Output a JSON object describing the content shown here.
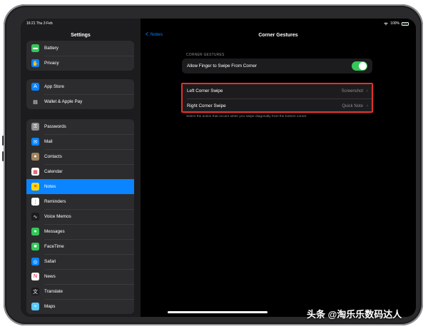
{
  "status": {
    "time_date": "16:21  Thu 3 Feb",
    "battery": "100%"
  },
  "sidebar": {
    "title": "Settings",
    "group1": [
      {
        "label": "Battery",
        "icon": "battery-icon",
        "color": "#34c759",
        "glyph": "▬"
      },
      {
        "label": "Privacy",
        "icon": "hand-icon",
        "color": "#0a84ff",
        "glyph": "✋"
      }
    ],
    "group2": [
      {
        "label": "App Store",
        "icon": "app-store-icon",
        "color": "#0a84ff",
        "glyph": "A"
      },
      {
        "label": "Wallet & Apple Pay",
        "icon": "wallet-icon",
        "color": "#2c2c2e",
        "glyph": "▤"
      }
    ],
    "group3": [
      {
        "label": "Passwords",
        "icon": "key-icon",
        "color": "#8e8e93",
        "glyph": "⚿"
      },
      {
        "label": "Mail",
        "icon": "mail-icon",
        "color": "#0a84ff",
        "glyph": "✉"
      },
      {
        "label": "Contacts",
        "icon": "contacts-icon",
        "color": "#a2845e",
        "glyph": "●"
      },
      {
        "label": "Calendar",
        "icon": "calendar-icon",
        "color": "#ffffff",
        "glyph": "▦"
      },
      {
        "label": "Notes",
        "icon": "notes-icon",
        "color": "#ffd60a",
        "glyph": "≡",
        "selected": true
      },
      {
        "label": "Reminders",
        "icon": "reminders-icon",
        "color": "#ffffff",
        "glyph": "⋮"
      },
      {
        "label": "Voice Memos",
        "icon": "voice-memos-icon",
        "color": "#1c1c1e",
        "glyph": "∿"
      },
      {
        "label": "Messages",
        "icon": "messages-icon",
        "color": "#34c759",
        "glyph": "●"
      },
      {
        "label": "FaceTime",
        "icon": "facetime-icon",
        "color": "#34c759",
        "glyph": "■"
      },
      {
        "label": "Safari",
        "icon": "safari-icon",
        "color": "#0a84ff",
        "glyph": "◎"
      },
      {
        "label": "News",
        "icon": "news-icon",
        "color": "#ffffff",
        "glyph": "N"
      },
      {
        "label": "Translate",
        "icon": "translate-icon",
        "color": "#1c1c1e",
        "glyph": "文"
      },
      {
        "label": "Maps",
        "icon": "maps-icon",
        "color": "#5ac8fa",
        "glyph": "⌖"
      }
    ]
  },
  "main": {
    "back_label": "Notes",
    "title": "Corner Gestures",
    "section_header": "CORNER GESTURES",
    "allow_row": {
      "label": "Allow Finger to Swipe From Corner",
      "toggle_on": true
    },
    "left_row": {
      "label": "Left Corner Swipe",
      "value": "Screenshot"
    },
    "right_row": {
      "label": "Right Corner Swipe",
      "value": "Quick Note"
    },
    "footnote": "Select the action that occurs when you swipe diagonally from the bottom corner."
  },
  "watermark": "头条 @淘乐乐数码达人",
  "colors": {
    "accent": "#0a84ff",
    "toggle": "#34c759",
    "highlight": "#e8302b"
  }
}
